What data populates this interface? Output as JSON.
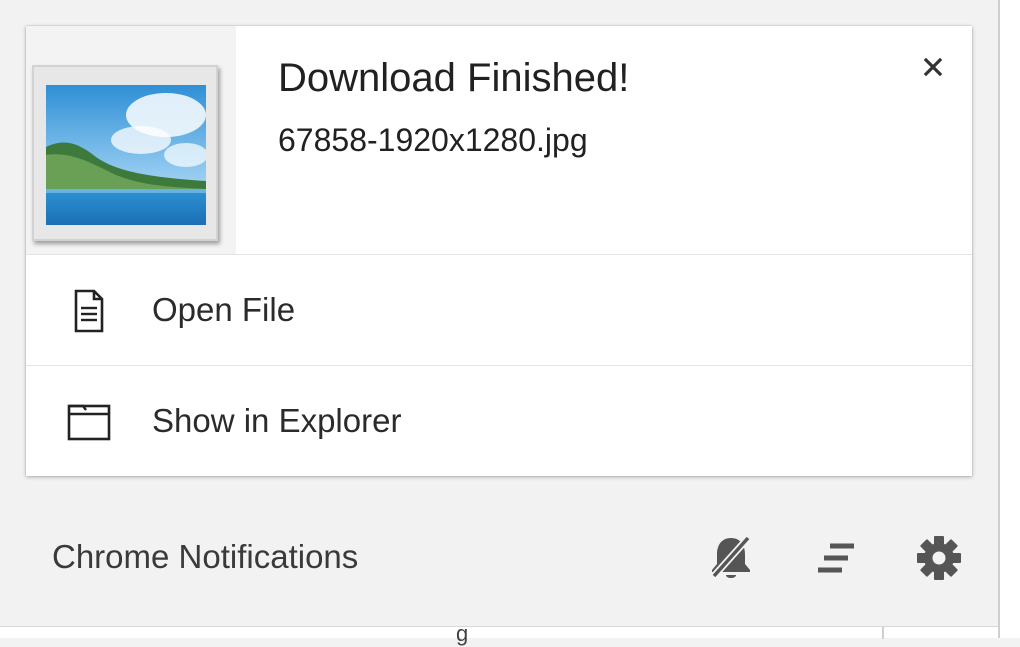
{
  "notification": {
    "title": "Download Finished!",
    "filename": "67858-1920x1280.jpg",
    "thumbnail_icon": "landscape-image-thumbnail",
    "close_icon": "close-icon"
  },
  "actions": [
    {
      "label": "Open File",
      "icon": "document-icon"
    },
    {
      "label": "Show in Explorer",
      "icon": "folder-icon"
    }
  ],
  "footer": {
    "title": "Chrome Notifications",
    "buttons": [
      {
        "name": "do-not-disturb",
        "icon": "bell-off-icon"
      },
      {
        "name": "clear-all",
        "icon": "clear-all-icon"
      },
      {
        "name": "settings",
        "icon": "gear-icon"
      }
    ]
  },
  "colors": {
    "panel_background": "#f2f2f2",
    "card_background": "#ffffff",
    "text_primary": "#212121",
    "icon_color": "#555555"
  }
}
